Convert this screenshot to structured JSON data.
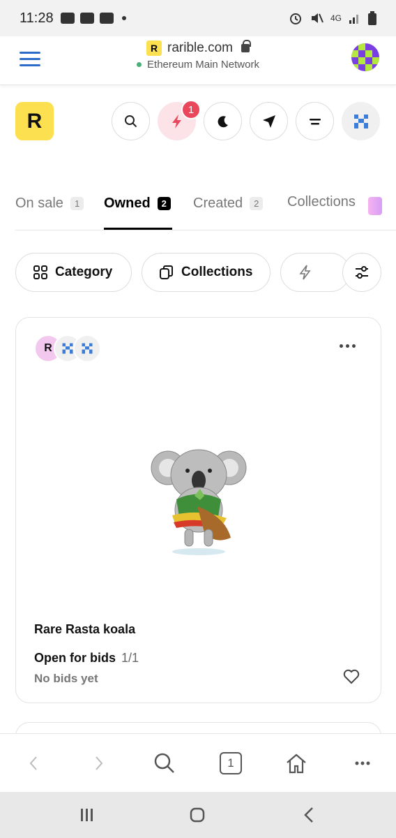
{
  "status_bar": {
    "time": "11:28",
    "network": "4G"
  },
  "browser": {
    "url": "rarible.com",
    "favicon_letter": "R",
    "network_label": "Ethereum Main Network",
    "tab_count": "1"
  },
  "header": {
    "logo_letter": "R",
    "notification_count": "1"
  },
  "tabs": [
    {
      "label": "On sale",
      "count": "1",
      "active": false
    },
    {
      "label": "Owned",
      "count": "2",
      "active": true
    },
    {
      "label": "Created",
      "count": "2",
      "active": false
    },
    {
      "label": "Collections",
      "count": "",
      "active": false
    }
  ],
  "filters": {
    "category_label": "Category",
    "collections_label": "Collections"
  },
  "card": {
    "avatar_letter": "R",
    "title": "Rare Rasta koala",
    "price_label": "Open for bids",
    "edition": "1/1",
    "bids_label": "No bids yet"
  },
  "colors": {
    "accent_yellow": "#fde050",
    "notification_red": "#e9485c",
    "network_green": "#4cae7a",
    "menu_blue": "#2c6cc9"
  }
}
